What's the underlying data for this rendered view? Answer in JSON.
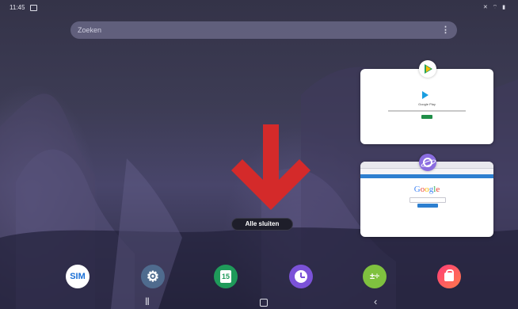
{
  "status_bar": {
    "time": "11:45",
    "icons": "✕ ⌔ ▮"
  },
  "search": {
    "placeholder": "Zoeken",
    "more_glyph": "⋮"
  },
  "recent_apps": [
    {
      "name": "Play Store",
      "icon": "play-store-icon",
      "title": "Google Play"
    },
    {
      "name": "Internet",
      "icon": "browser-icon",
      "title": "Google"
    }
  ],
  "google_letters": [
    "G",
    "o",
    "o",
    "g",
    "l",
    "e"
  ],
  "close_all_label": "Alle sluiten",
  "dock": {
    "sim_label": "SIM",
    "settings_glyph": "⚙",
    "calendar_day": "15",
    "calc_glyph": "±÷",
    "store_glyph": ""
  },
  "nav": {
    "recent_glyph": "|||",
    "back_glyph": "‹"
  },
  "colors": {
    "accent_arrow": "#d42a2a",
    "wallpaper_base": "#343348"
  }
}
